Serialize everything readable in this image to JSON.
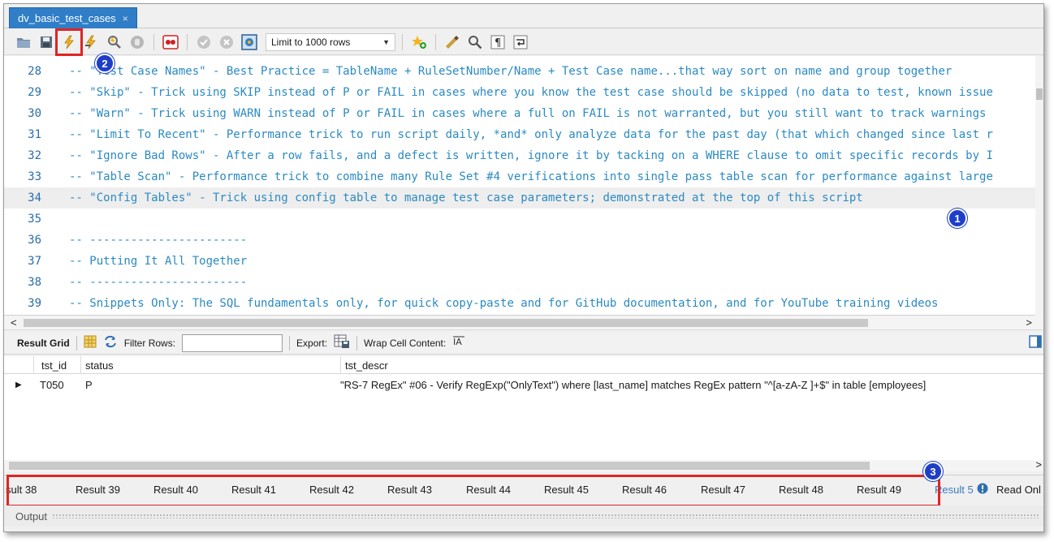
{
  "tab": {
    "title": "dv_basic_test_cases",
    "close_glyph": "×"
  },
  "toolbar": {
    "icons": [
      "folder-open-icon",
      "save-icon",
      "execute-icon",
      "execute-current-icon",
      "explain-icon",
      "stop-icon",
      "toggle-error-icon",
      "commit-icon",
      "rollback-icon",
      "autocommit-icon",
      "beautify-icon",
      "find-icon",
      "invisibles-icon",
      "wrap-icon",
      "bookmark-icon"
    ],
    "limit_label": "Limit to 1000 rows",
    "highlight_color": "#e02424"
  },
  "editor": {
    "lines": [
      {
        "num": "28",
        "text": "-- \"Test Case Names\" - Best Practice = TableName + RuleSetNumber/Name + Test Case name...that way sort on name and group together"
      },
      {
        "num": "29",
        "text": "-- \"Skip\" - Trick using SKIP instead of P or FAIL in cases where you know the test case should be skipped (no data to test, known issue"
      },
      {
        "num": "30",
        "text": "-- \"Warn\" - Trick using WARN instead of P or FAIL in cases where a full on FAIL is not warranted, but you still want to track warnings"
      },
      {
        "num": "31",
        "text": "-- \"Limit To Recent\" - Performance trick to run script daily, *and* only analyze data for the past day (that which changed since last r"
      },
      {
        "num": "32",
        "text": "-- \"Ignore Bad Rows\" - After a row fails, and a defect is written, ignore it by tacking on a WHERE clause to omit specific records by I"
      },
      {
        "num": "33",
        "text": "-- \"Table Scan\" - Performance trick to combine many Rule Set #4 verifications into single pass table scan for performance against large"
      },
      {
        "num": "34",
        "text": "-- \"Config Tables\" - Trick using config table to manage test case parameters; demonstrated at the top of this script",
        "active": true
      },
      {
        "num": "35",
        "text": ""
      },
      {
        "num": "36",
        "text": "-- -----------------------"
      },
      {
        "num": "37",
        "text": "-- Putting It All Together"
      },
      {
        "num": "38",
        "text": "-- -----------------------"
      },
      {
        "num": "39",
        "text": "-- Snippets Only: The SQL fundamentals only, for quick copy-paste and for GitHub documentation, and for YouTube training videos"
      }
    ],
    "scroll_left": "<",
    "scroll_right": ">"
  },
  "result_bar": {
    "grid_label": "Result Grid",
    "filter_label": "Filter Rows:",
    "filter_value": "",
    "export_label": "Export:",
    "wrap_label": "Wrap Cell Content:"
  },
  "grid": {
    "columns": [
      "tst_id",
      "status",
      "tst_descr"
    ],
    "rows": [
      {
        "tst_id": "T050",
        "status": "P",
        "tst_descr": "\"RS-7 RegEx\" #06 - Verify RegExp(\"OnlyText\") where [last_name] matches RegEx pattern \"^[a-zA-Z ]+$\" in table [employees]"
      }
    ]
  },
  "result_tabs": [
    "sult 38",
    "Result 39",
    "Result 40",
    "Result 41",
    "Result 42",
    "Result 43",
    "Result 44",
    "Result 45",
    "Result 46",
    "Result 47",
    "Result 48",
    "Result 49",
    "Result 5"
  ],
  "read_only": "Read Onl",
  "output_label": "Output",
  "callouts": [
    "1",
    "2",
    "3"
  ],
  "colors": {
    "accent": "#2f7ec7",
    "comment": "#2b8ac2",
    "badge": "#1e3ec9",
    "highlight": "#e02424"
  }
}
